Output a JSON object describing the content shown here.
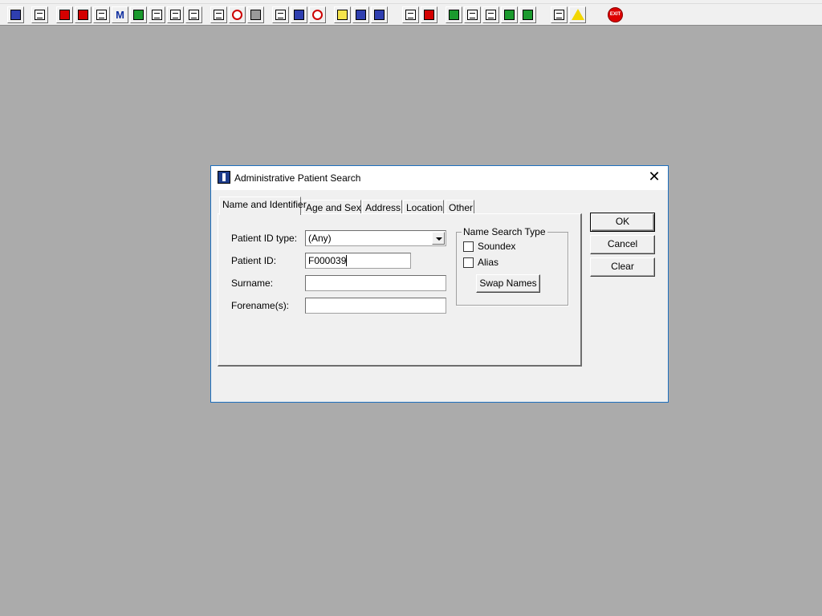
{
  "toolbar": {
    "buttons": [
      {
        "icon": "patient-icon"
      },
      {
        "icon": "printer-icon"
      },
      {
        "icon": "red-book-icon"
      },
      {
        "icon": "folder-edit-icon"
      },
      {
        "icon": "document-search-icon"
      },
      {
        "icon": "letter-m-icon"
      },
      {
        "icon": "doctor-icon"
      },
      {
        "icon": "form-edit-icon"
      },
      {
        "icon": "flag-icon"
      },
      {
        "icon": "flag-alt-icon"
      },
      {
        "icon": "list-cancel-icon"
      },
      {
        "icon": "clock-icon"
      },
      {
        "icon": "monitor-icon"
      },
      {
        "icon": "report-icon"
      },
      {
        "icon": "chart-document-icon"
      },
      {
        "icon": "no-entry-icon"
      },
      {
        "icon": "notepad-icon"
      },
      {
        "icon": "bed-icon"
      },
      {
        "icon": "transfer-icon"
      },
      {
        "icon": "blank-page-icon"
      },
      {
        "icon": "bar-chart-icon"
      },
      {
        "icon": "globe-icon"
      },
      {
        "icon": "message-icon"
      },
      {
        "icon": "message-down-icon"
      },
      {
        "icon": "message-green-icon"
      },
      {
        "icon": "message-swap-icon"
      },
      {
        "icon": "swap-arrows-icon"
      },
      {
        "icon": "warning-icon"
      },
      {
        "icon": "exit-icon",
        "text": "EXIT"
      }
    ]
  },
  "dialog": {
    "title": "Administrative Patient Search",
    "tabs": [
      "Name and Identifier",
      "Age and Sex",
      "Address",
      "Location",
      "Other"
    ],
    "fields": {
      "id_type": {
        "label": "Patient ID type:",
        "value": "(Any)"
      },
      "patient_id": {
        "label": "Patient ID:",
        "value": "F000039"
      },
      "surname": {
        "label": "Surname:",
        "value": ""
      },
      "forename": {
        "label": "Forename(s):",
        "value": ""
      }
    },
    "name_search": {
      "title": "Name Search Type",
      "soundex": "Soundex",
      "alias": "Alias",
      "swap": "Swap Names"
    },
    "buttons": {
      "ok": "OK",
      "cancel": "Cancel",
      "clear": "Clear"
    }
  }
}
